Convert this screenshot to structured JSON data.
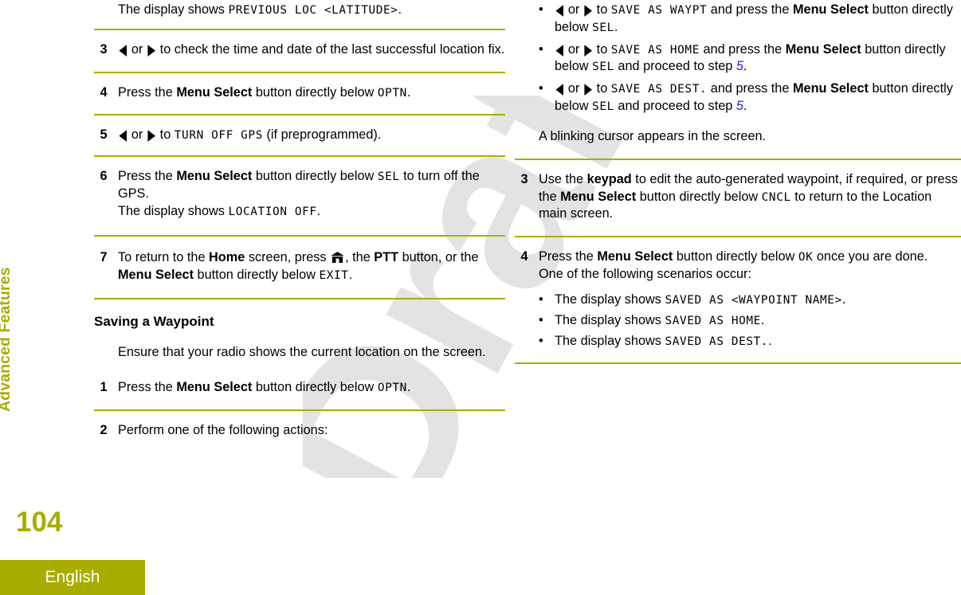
{
  "sidebar": {
    "chapter": "Advanced Features",
    "page_number": "104",
    "language": "English"
  },
  "icons": {
    "arrow_left": "arrow-left-icon",
    "arrow_right": "arrow-right-icon",
    "home": "home-icon"
  },
  "colors": {
    "rule": "#a8ad00",
    "accent": "#a8ad00",
    "xref": "#2222cc",
    "watermark": "#e3e3e3"
  },
  "watermark": {
    "text": "Draft"
  },
  "left_column": {
    "lead_in": {
      "prefix": "The display shows ",
      "display": "PREVIOUS LOC <LATITUDE>",
      "suffix": "."
    },
    "steps": [
      {
        "num": "3",
        "parts": [
          {
            "t": "arrow_pair"
          },
          {
            "t": "text",
            "v": " to check the time and date of the last successful location fix."
          }
        ]
      },
      {
        "num": "4",
        "parts": [
          {
            "t": "text",
            "v": "Press the "
          },
          {
            "t": "bold",
            "v": "Menu Select"
          },
          {
            "t": "text",
            "v": " button directly below "
          },
          {
            "t": "disp",
            "v": "OPTN"
          },
          {
            "t": "text",
            "v": "."
          }
        ]
      },
      {
        "num": "5",
        "parts": [
          {
            "t": "arrow_pair"
          },
          {
            "t": "text",
            "v": " to "
          },
          {
            "t": "disp",
            "v": "TURN OFF GPS"
          },
          {
            "t": "text",
            "v": " (if preprogrammed)."
          }
        ]
      },
      {
        "num": "6",
        "parts": [
          {
            "t": "text",
            "v": "Press the "
          },
          {
            "t": "bold",
            "v": "Menu Select"
          },
          {
            "t": "text",
            "v": " button directly below "
          },
          {
            "t": "disp",
            "v": "SEL"
          },
          {
            "t": "text",
            "v": " to turn off the GPS."
          },
          {
            "t": "br"
          },
          {
            "t": "text",
            "v": "The display shows "
          },
          {
            "t": "disp",
            "v": "LOCATION OFF"
          },
          {
            "t": "text",
            "v": "."
          }
        ]
      },
      {
        "num": "7",
        "parts": [
          {
            "t": "text",
            "v": "To return to the "
          },
          {
            "t": "bold",
            "v": "Home"
          },
          {
            "t": "text",
            "v": " screen, press "
          },
          {
            "t": "home"
          },
          {
            "t": "text",
            "v": ", the "
          },
          {
            "t": "bold",
            "v": "PTT"
          },
          {
            "t": "text",
            "v": " button, or the "
          },
          {
            "t": "bold",
            "v": "Menu Select"
          },
          {
            "t": "text",
            "v": " button directly below "
          },
          {
            "t": "disp",
            "v": "EXIT"
          },
          {
            "t": "text",
            "v": "."
          }
        ]
      }
    ],
    "section": {
      "heading": "Saving a Waypoint",
      "intro": "Ensure that your radio shows the current location on the screen.",
      "steps": [
        {
          "num": "1",
          "parts": [
            {
              "t": "text",
              "v": "Press the "
            },
            {
              "t": "bold",
              "v": "Menu Select"
            },
            {
              "t": "text",
              "v": " button directly below "
            },
            {
              "t": "disp",
              "v": "OPTN"
            },
            {
              "t": "text",
              "v": "."
            }
          ]
        },
        {
          "num": "2",
          "parts": [
            {
              "t": "text",
              "v": "Perform one of the following actions:"
            }
          ]
        }
      ]
    }
  },
  "right_column": {
    "bullets_top": [
      {
        "parts": [
          {
            "t": "arrow_pair"
          },
          {
            "t": "text",
            "v": " to "
          },
          {
            "t": "disp",
            "v": "SAVE AS WAYPT"
          },
          {
            "t": "text",
            "v": " and press the "
          },
          {
            "t": "bold",
            "v": "Menu Select"
          },
          {
            "t": "text",
            "v": " button directly below "
          },
          {
            "t": "disp",
            "v": "SEL"
          },
          {
            "t": "text",
            "v": "."
          }
        ]
      },
      {
        "parts": [
          {
            "t": "arrow_pair"
          },
          {
            "t": "text",
            "v": " to "
          },
          {
            "t": "disp",
            "v": "SAVE AS HOME"
          },
          {
            "t": "text",
            "v": " and press the "
          },
          {
            "t": "bold",
            "v": "Menu Select"
          },
          {
            "t": "text",
            "v": " button directly below "
          },
          {
            "t": "disp",
            "v": "SEL"
          },
          {
            "t": "text",
            "v": " and proceed to step "
          },
          {
            "t": "xref",
            "v": "5"
          },
          {
            "t": "text",
            "v": "."
          }
        ]
      },
      {
        "parts": [
          {
            "t": "arrow_pair"
          },
          {
            "t": "text",
            "v": " to "
          },
          {
            "t": "disp",
            "v": "SAVE AS DEST."
          },
          {
            "t": "text",
            "v": " and press the "
          },
          {
            "t": "bold",
            "v": "Menu Select"
          },
          {
            "t": "text",
            "v": " button directly below "
          },
          {
            "t": "disp",
            "v": "SEL"
          },
          {
            "t": "text",
            "v": " and proceed to step "
          },
          {
            "t": "xref",
            "v": "5"
          },
          {
            "t": "text",
            "v": "."
          }
        ]
      }
    ],
    "after_bullets": "A blinking cursor appears in the screen.",
    "steps": [
      {
        "num": "3",
        "parts": [
          {
            "t": "text",
            "v": "Use the "
          },
          {
            "t": "bold",
            "v": "keypad"
          },
          {
            "t": "text",
            "v": " to edit the auto-generated waypoint, if required, or press the "
          },
          {
            "t": "bold",
            "v": "Menu Select"
          },
          {
            "t": "text",
            "v": " button directly below "
          },
          {
            "t": "disp",
            "v": "CNCL"
          },
          {
            "t": "text",
            "v": " to return to the Location main screen."
          }
        ]
      },
      {
        "num": "4",
        "parts": [
          {
            "t": "text",
            "v": "Press the "
          },
          {
            "t": "bold",
            "v": "Menu Select"
          },
          {
            "t": "text",
            "v": " button directly below "
          },
          {
            "t": "disp",
            "v": "OK"
          },
          {
            "t": "text",
            "v": " once you are done."
          },
          {
            "t": "br"
          },
          {
            "t": "text",
            "v": "One of the following scenarios occur:"
          }
        ]
      }
    ],
    "bullets_bottom": [
      {
        "parts": [
          {
            "t": "text",
            "v": "The display shows "
          },
          {
            "t": "disp",
            "v": "SAVED AS <WAYPOINT NAME>"
          },
          {
            "t": "text",
            "v": "."
          }
        ]
      },
      {
        "parts": [
          {
            "t": "text",
            "v": "The display shows "
          },
          {
            "t": "disp",
            "v": "SAVED AS HOME"
          },
          {
            "t": "text",
            "v": "."
          }
        ]
      },
      {
        "parts": [
          {
            "t": "text",
            "v": "The display shows "
          },
          {
            "t": "disp",
            "v": "SAVED AS DEST."
          },
          {
            "t": "text",
            "v": "."
          }
        ]
      }
    ]
  }
}
